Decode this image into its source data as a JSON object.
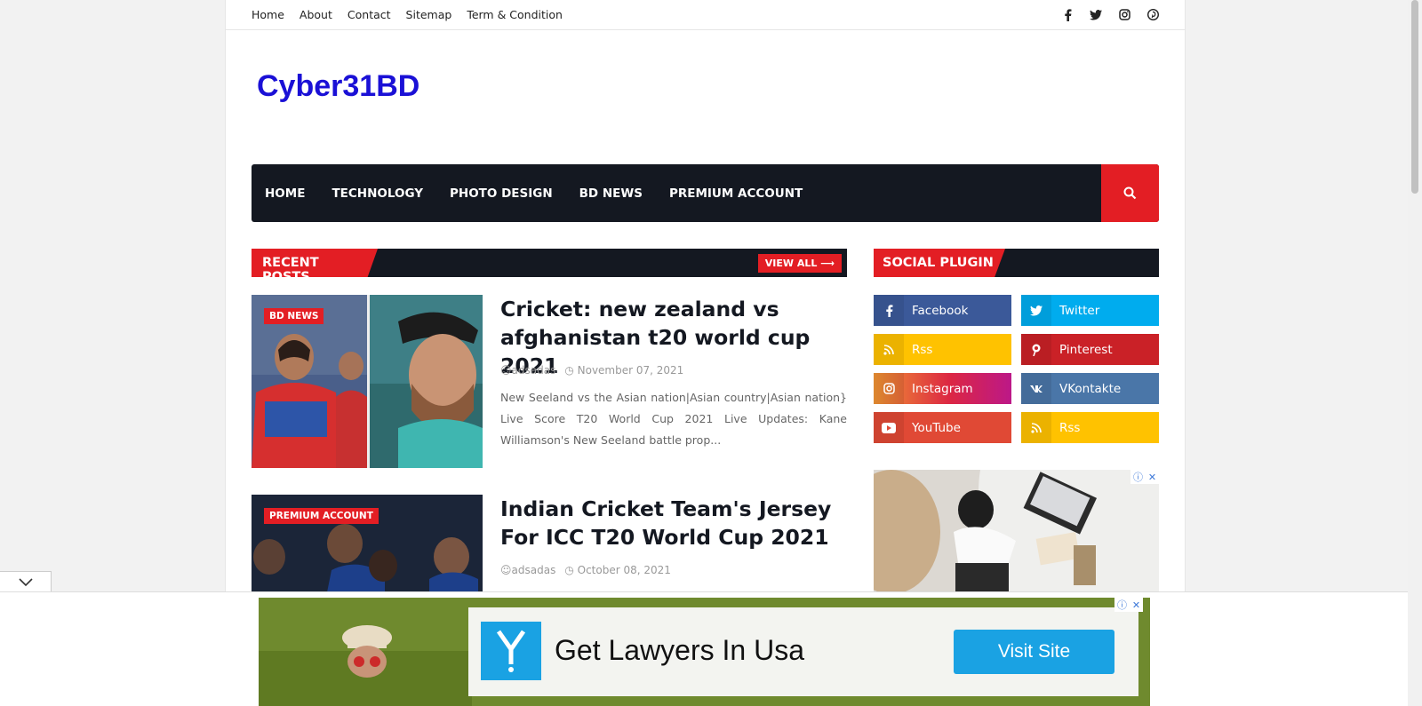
{
  "topbar": {
    "links": [
      "Home",
      "About",
      "Contact",
      "Sitemap",
      "Term & Condition"
    ],
    "social_icons": [
      "facebook-icon",
      "twitter-icon",
      "instagram-icon",
      "pinterest-icon"
    ]
  },
  "header": {
    "logo": "Cyber31BD"
  },
  "nav": {
    "items": [
      "HOME",
      "TECHNOLOGY",
      "PHOTO DESIGN",
      "BD NEWS",
      "PREMIUM ACCOUNT"
    ],
    "search_icon": "search-icon"
  },
  "recent": {
    "title": "RECENT POSTS",
    "view_all": "VIEW ALL ⟶",
    "posts": [
      {
        "category": "BD NEWS",
        "title": "Cricket: new zealand vs afghanistan t20 world cup 2021",
        "author": "adsadas",
        "date": "November 07, 2021",
        "excerpt": "New Seeland vs the Asian nation|Asian country|Asian nation} Live Score T20 World Cup 2021 Live Updates: Kane Williamson's New Seeland battle prop..."
      },
      {
        "category": "PREMIUM ACCOUNT",
        "title": "Indian Cricket Team's Jersey For ICC T20 World Cup 2021",
        "author": "adsadas",
        "date": "October 08, 2021"
      }
    ]
  },
  "social": {
    "title": "SOCIAL PLUGIN",
    "items": [
      {
        "label": "Facebook",
        "icon": "facebook-icon",
        "color": "#3b5999"
      },
      {
        "label": "Twitter",
        "icon": "twitter-icon",
        "color": "#00acee"
      },
      {
        "label": "Rss",
        "icon": "rss-icon",
        "color": "#ffc200"
      },
      {
        "label": "Pinterest",
        "icon": "pinterest-icon",
        "color": "#ca2127"
      },
      {
        "label": "Instagram",
        "icon": "instagram-icon",
        "color": "#dd277b"
      },
      {
        "label": "VKontakte",
        "icon": "vk-icon",
        "color": "#4a76a8"
      },
      {
        "label": "YouTube",
        "icon": "youtube-icon",
        "color": "#e04935"
      },
      {
        "label": "Rss",
        "icon": "rss-icon",
        "color": "#ffc200"
      }
    ]
  },
  "bottom_ad": {
    "headline": "Get Lawyers In Usa",
    "cta": "Visit Site"
  },
  "colors": {
    "accent": "#e31e24",
    "nav_bg": "#141821",
    "logo": "#1a10d6"
  }
}
